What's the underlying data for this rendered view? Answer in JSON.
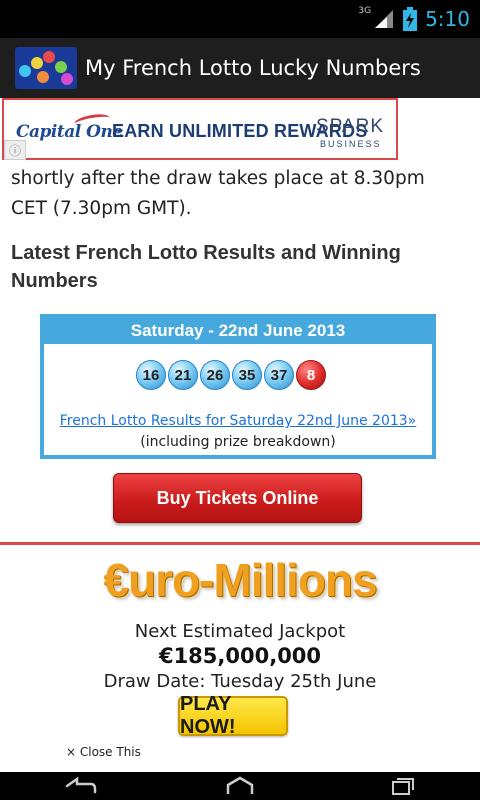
{
  "status_bar": {
    "network": "3G",
    "time": "5:10",
    "icons": [
      "signal-icon",
      "battery-icon"
    ]
  },
  "app_bar": {
    "title": "My French Lotto Lucky Numbers",
    "icon": "app-lottery-balls-icon"
  },
  "top_ad": {
    "brand": "Capital One",
    "headline": "EARN UNLIMITED REWARDS",
    "spark": "SPARK",
    "spark_sub": "BUSINESS",
    "info_icon": "info-icon"
  },
  "article": {
    "intro_text": "shortly after the draw takes place at 8.30pm CET (7.30pm GMT).",
    "heading": "Latest French Lotto Results and Winning Numbers"
  },
  "results": {
    "date_header": "Saturday - 22nd June 2013",
    "main_numbers": [
      "16",
      "21",
      "26",
      "35",
      "37"
    ],
    "bonus_number": "8",
    "link_text": "French Lotto Results for Saturday 22nd June 2013»",
    "sub_text": "(including prize breakdown)"
  },
  "buy_button": {
    "label": "Buy Tickets Online"
  },
  "euro_ad": {
    "logo": "€uro-Millions",
    "jackpot_label": "Next Estimated Jackpot",
    "jackpot_amount": "€185,000,000",
    "draw_date": "Draw Date: Tuesday 25th June",
    "play_label": "PLAY NOW!",
    "close_label": "× Close This"
  },
  "colors": {
    "accent_blue": "#46a8dc",
    "button_red": "#cc1c1c",
    "ad_border": "#d9484a",
    "status_blue": "#33b5e5"
  },
  "nav": {
    "back_icon": "back-icon",
    "home_icon": "home-icon",
    "recents_icon": "recents-icon"
  }
}
